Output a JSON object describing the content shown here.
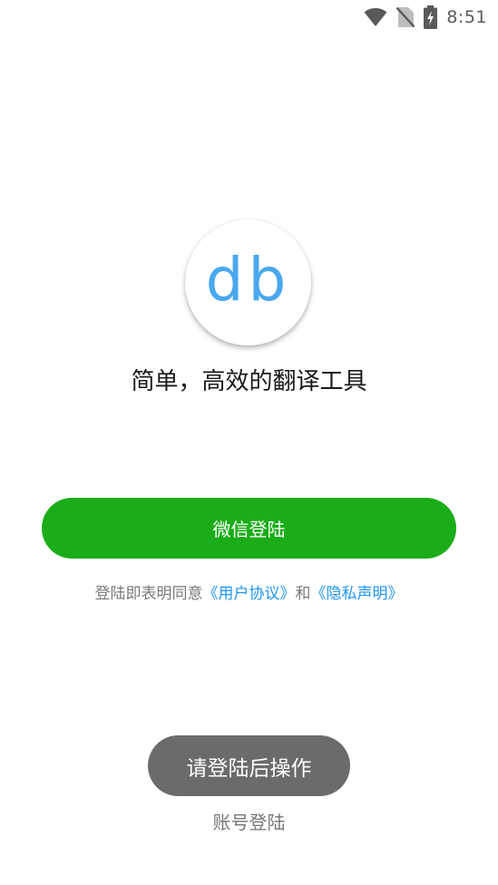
{
  "status_bar": {
    "time": "8:51",
    "icons": [
      "wifi-icon",
      "no-sim-icon",
      "battery-charging-icon"
    ]
  },
  "logo": {
    "text": "db",
    "color": "#4aa8ef"
  },
  "slogan": "简单，高效的翻译工具",
  "wechat_login": {
    "label": "微信登陆",
    "color": "#1aad19"
  },
  "agreement": {
    "prefix": "登陆即表明同意",
    "user_agreement": "《用户协议》",
    "conjunction": "和",
    "privacy": "《隐私声明》",
    "link_color": "#2196f3"
  },
  "toast": {
    "text": "请登陆后操作"
  },
  "account_login": {
    "label": "账号登陆"
  }
}
